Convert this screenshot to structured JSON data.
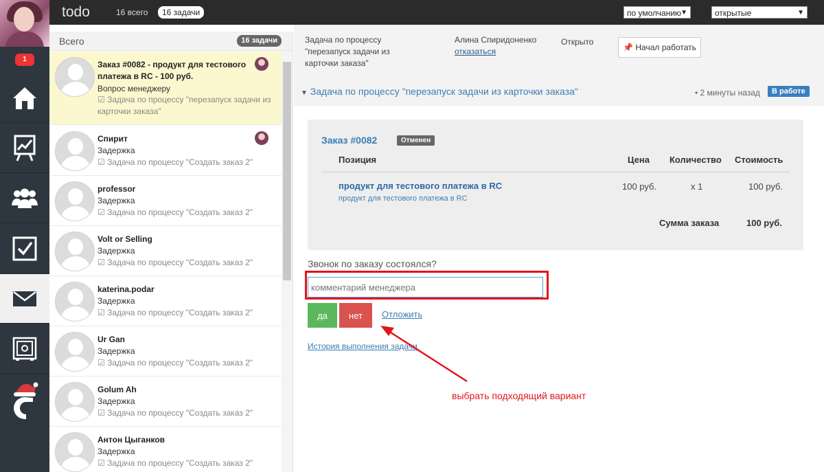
{
  "topbar": {
    "app_title": "todo",
    "total_label": "16 всего",
    "tasks_badge": "16 задачи",
    "sort_select": "по умолчанию",
    "status_select": "открытые"
  },
  "sidebar": {
    "notification_count": "1",
    "items": [
      {
        "icon": "home-icon"
      },
      {
        "icon": "chart-icon"
      },
      {
        "icon": "users-icon"
      },
      {
        "icon": "checkbox-icon"
      },
      {
        "icon": "mail-icon",
        "active": true
      },
      {
        "icon": "safe-icon"
      },
      {
        "icon": "santa-c-logo-icon"
      }
    ]
  },
  "list": {
    "header_label": "Всего",
    "header_count": "16 задачи",
    "tasks": [
      {
        "name_l1": "Заказ #0082 - продукт для тестового",
        "name_l2": "платежа в RC - 100 руб.",
        "sub": "Вопрос менеджеру",
        "proc_l1": "Задача по процессу \"перезапуск задачи из",
        "proc_l2": "карточки заказа\""
      },
      {
        "name": "Спирит",
        "sub": "Задержка",
        "proc": "Задача по процессу \"Создать заказ 2\""
      },
      {
        "name": "professor",
        "sub": "Задержка",
        "proc": "Задача по процессу \"Создать заказ 2\""
      },
      {
        "name": "Volt or Selling",
        "sub": "Задержка",
        "proc": "Задача по процессу \"Создать заказ 2\""
      },
      {
        "name": "katerina.podar",
        "sub": "Задержка",
        "proc": "Задача по процессу \"Создать заказ 2\""
      },
      {
        "name": "Ur Gan",
        "sub": "Задержка",
        "proc": "Задача по процессу \"Создать заказ 2\""
      },
      {
        "name": "Golum Ah",
        "sub": "Задержка",
        "proc": "Задача по процессу \"Создать заказ 2\""
      },
      {
        "name": "Антон Цыганков",
        "sub": "Задержка",
        "proc": "Задача по процессу \"Создать заказ 2\""
      }
    ]
  },
  "detail": {
    "process_l1": "Задача по процессу",
    "process_l2": "\"перезапуск задачи из",
    "process_l3": "карточки заказа\"",
    "assignee": "Алина Спиридоненко",
    "refuse_link": "отказаться",
    "status": "Открыто",
    "start_button": "Начал работать",
    "title": "Задача по процессу \"перезапуск задачи из карточки заказа\"",
    "time_ago": "• 2 минуты назад",
    "work_badge": "В работе",
    "order": {
      "number": "Заказ #0082",
      "status_badge": "Отменен",
      "col_position": "Позиция",
      "col_price": "Цена",
      "col_qty": "Количество",
      "col_cost": "Стоимость",
      "product_name": "продукт для тестового платежа в RC",
      "product_sub": "продукт для тестового платежа в RC",
      "price": "100 руб.",
      "qty": "x 1",
      "cost": "100 руб.",
      "sum_label": "Сумма заказа",
      "sum_value": "100 руб."
    },
    "question": "Звонок по заказу состоялся?",
    "comment_placeholder": "комментарий менеджера",
    "yes_button": "да",
    "no_button": "нет",
    "postpone_link": "Отложить",
    "history_link": "История выполнения задачи",
    "annotation_hint": "выбрать подходящий вариант"
  },
  "colors": {
    "accent_blue": "#3c7db3",
    "yes_green": "#5cb85c",
    "no_red": "#d9534f",
    "annotation_red": "#e3141b"
  }
}
